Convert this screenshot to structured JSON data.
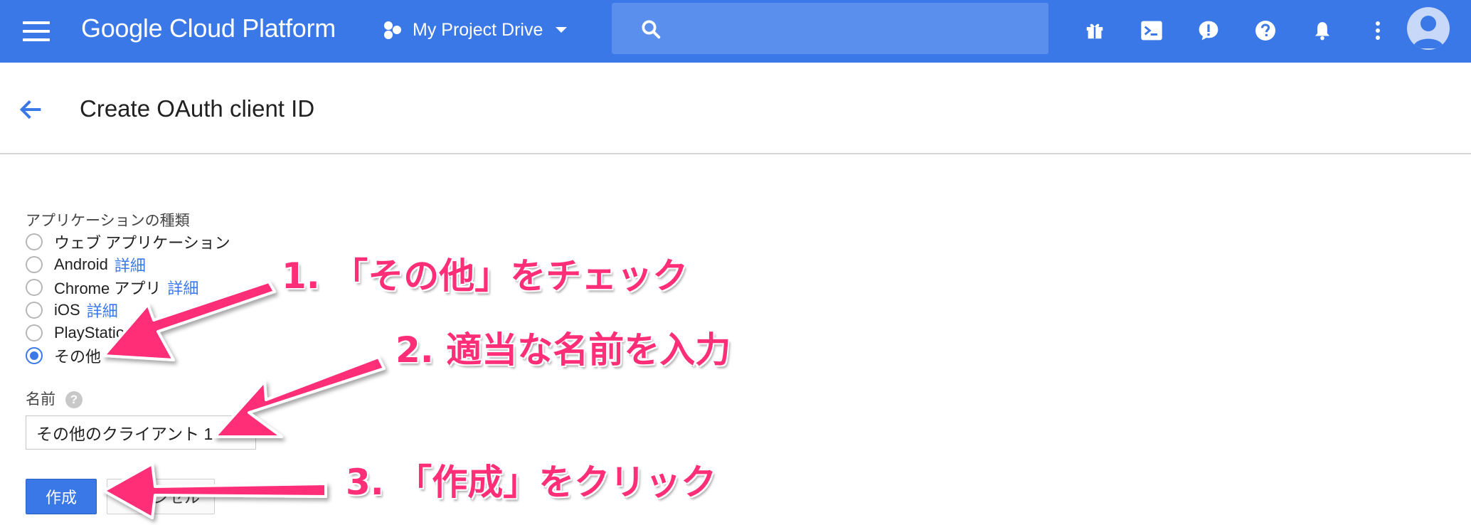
{
  "topbar": {
    "brand": "Google Cloud Platform",
    "project_name": "My Project Drive",
    "search_placeholder": "",
    "icons": [
      "gift-icon",
      "cloud-shell-icon",
      "feedback-icon",
      "help-icon",
      "notifications-icon",
      "more-vert-icon",
      "account-icon"
    ]
  },
  "page": {
    "title": "Create OAuth client ID"
  },
  "form": {
    "app_type_label": "アプリケーションの種類",
    "options": [
      {
        "label": "ウェブ アプリケーション",
        "link": "",
        "selected": false
      },
      {
        "label": "Android",
        "link": "詳細",
        "selected": false
      },
      {
        "label": "Chrome アプリ",
        "link": "詳細",
        "selected": false
      },
      {
        "label": "iOS",
        "link": "詳細",
        "selected": false
      },
      {
        "label": "PlayStation",
        "link": "",
        "selected": false
      },
      {
        "label": "その他",
        "link": "",
        "selected": true
      }
    ],
    "name_label": "名前",
    "help_glyph": "?",
    "name_value": "その他のクライアント 1",
    "create_label": "作成",
    "cancel_label": "キャンセル"
  },
  "annotations": {
    "step1": "1. 「その他」をチェック",
    "step2": "2. 適当な名前を入力",
    "step3": "3. 「作成」をクリック",
    "color": "#ff2e77"
  },
  "colors": {
    "topbar": "#3b78e7",
    "search": "#5b8fee",
    "accent": "#3b78e7"
  }
}
